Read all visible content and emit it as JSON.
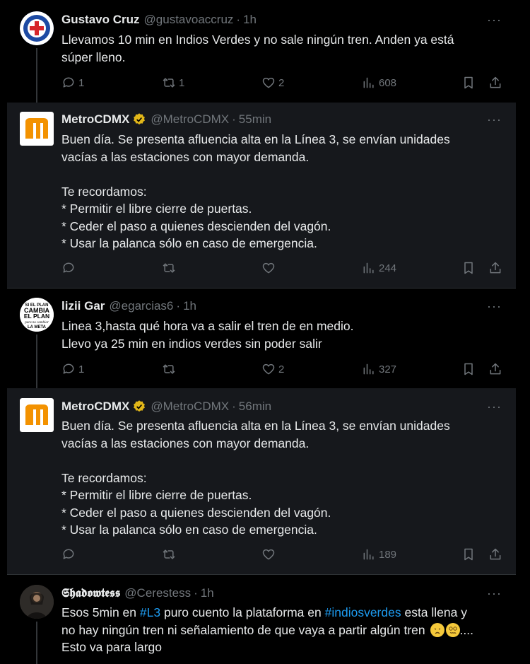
{
  "tweets": [
    {
      "name": "Gustavo Cruz",
      "handle": "@gustavoaccruz",
      "time": "1h",
      "body": [
        "Llevamos 10 min en Indios Verdes y no sale ningún tren. Anden ya está",
        "súper lleno."
      ],
      "replies": "1",
      "retweets": "1",
      "likes": "2",
      "views": "608"
    },
    {
      "name": "MetroCDMX",
      "handle": "@MetroCDMX",
      "time": "55min",
      "body": [
        "Buen día. Se presenta afluencia alta en la Línea 3, se envían unidades",
        "vacías a las estaciones con mayor demanda.",
        "",
        "Te recordamos:",
        "* Permitir el libre cierre de puertas.",
        "* Ceder el paso a quienes descienden del vagón.",
        "* Usar la palanca sólo en caso de emergencia."
      ],
      "replies": "",
      "retweets": "",
      "likes": "",
      "views": "244"
    },
    {
      "name": "lizii Gar",
      "handle": "@egarcias6",
      "time": "1h",
      "body": [
        "Linea 3,hasta qué hora va a salir el tren de en medio.",
        "Llevo ya 25 min en indios verdes sin poder salir"
      ],
      "replies": "1",
      "retweets": "",
      "likes": "2",
      "views": "327",
      "avatar_text": [
        "SI EL PLAN",
        "CAMBIA",
        "EL PLAN",
        "para no cambiar",
        "LA META"
      ]
    },
    {
      "name": "MetroCDMX",
      "handle": "@MetroCDMX",
      "time": "56min",
      "body": [
        "Buen día. Se presenta afluencia alta en la Línea 3, se envían unidades",
        "vacías a las estaciones con mayor demanda.",
        "",
        "Te recordamos:",
        "* Permitir el libre cierre de puertas.",
        "* Ceder el paso a quienes descienden del vagón.",
        "* Usar la palanca sólo en caso de emergencia."
      ],
      "replies": "",
      "retweets": "",
      "likes": "",
      "views": "189"
    },
    {
      "name": "𝕾𝖍𝖆𝖉𝖔𝖜𝖙𝖊𝖘𝖘",
      "handle": "@Cerestess",
      "time": "1h",
      "body_parts": {
        "l1_a": "Esos 5min en ",
        "l1_tag1": "#L3",
        "l1_b": " puro cuento la plataforma en ",
        "l1_tag2": "#indiosverdes",
        "l1_c": " esta llena y",
        "l2": "no hay ningún tren ni señalamiento de que vaya a partir algún tren ",
        "l2_end": "....",
        "l3": "Esto va para largo"
      }
    }
  ],
  "separator": "·",
  "more_label": "···",
  "colors": {
    "background": "#000000",
    "reply_background": "#16181c",
    "muted": "#71767b",
    "link": "#1d9bf0",
    "verified": "#e2b719"
  }
}
